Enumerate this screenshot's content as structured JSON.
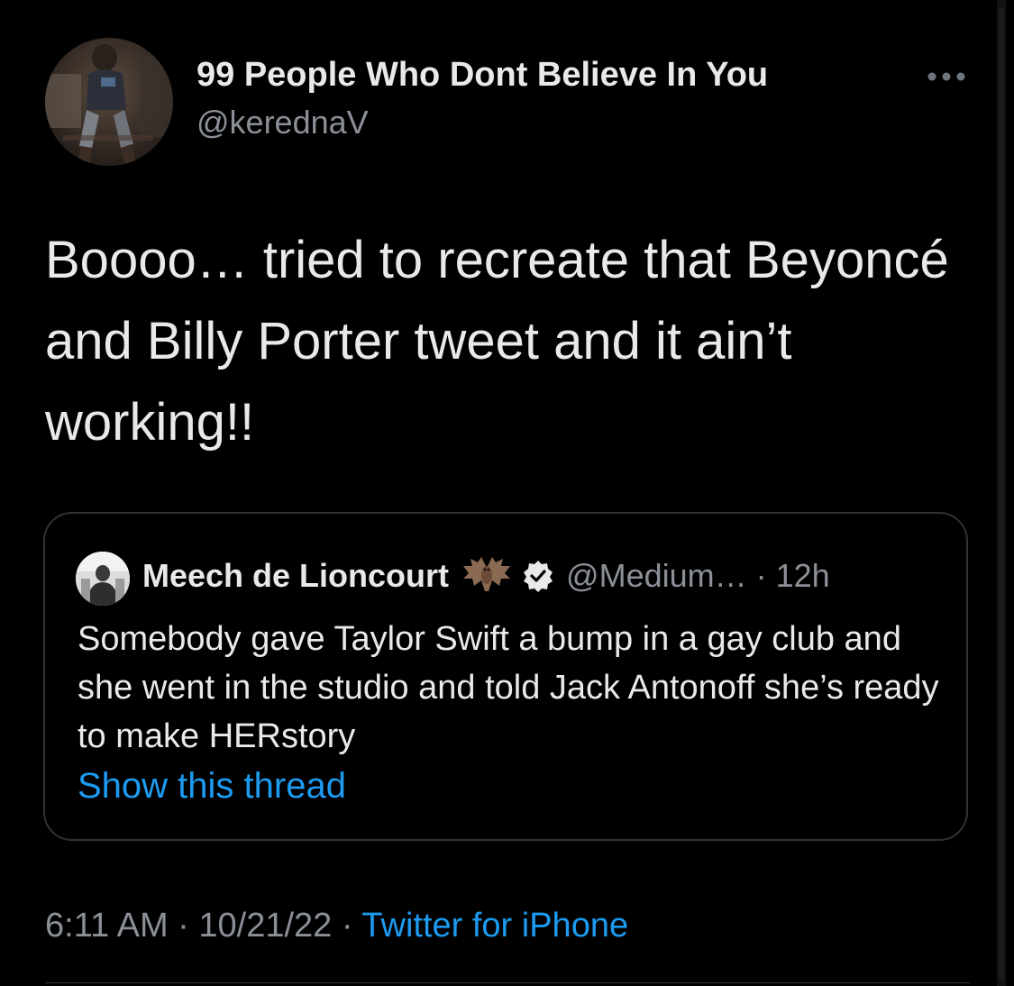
{
  "tweet": {
    "author_name": "99 People Who Dont Believe In You",
    "author_handle": "@kerednaV",
    "more_icon": "more-horizontal-icon",
    "text": "Boooo… tried to recreate that Beyoncé and Billy Porter tweet and it ain’t working!!",
    "time": "6:11 AM",
    "date": "10/21/22",
    "separator": "·",
    "source": "Twitter for iPhone"
  },
  "quote": {
    "author_name": "Meech de Lioncourt",
    "emoji_icon": "bat-emoji-icon",
    "verified_icon": "verified-badge-icon",
    "author_handle": "@Medium…",
    "separator": "·",
    "time": "12h",
    "text": "Somebody gave Taylor Swift a bump in a gay club and she went in the studio and told Jack Antonoff she’s ready to make HERstory",
    "show_thread": "Show this thread"
  },
  "colors": {
    "background": "#000000",
    "primary_text": "#e7e9ea",
    "secondary_text": "#8b9097",
    "link": "#1d9bf0",
    "border": "#2f3336"
  }
}
